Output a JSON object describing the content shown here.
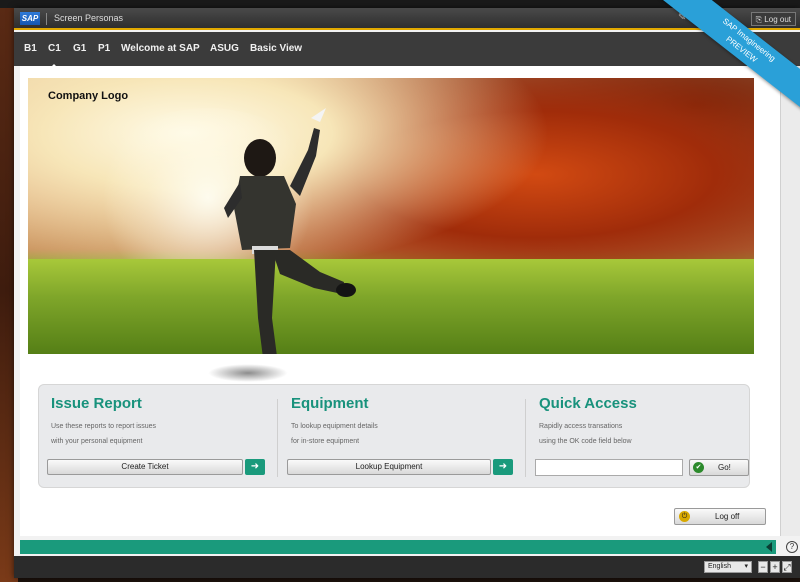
{
  "titlebar": {
    "app_logo": "SAP",
    "title": "Screen Personas",
    "logout_label": "Log out"
  },
  "tabs": [
    {
      "label": "B1"
    },
    {
      "label": "C1",
      "active": true
    },
    {
      "label": "G1"
    },
    {
      "label": "P1"
    },
    {
      "label": "Welcome at SAP"
    },
    {
      "label": "ASUG"
    },
    {
      "label": "Basic View"
    }
  ],
  "ribbon": {
    "line1": "SAP Imagineering",
    "line2": "PREVIEW"
  },
  "hero": {
    "company_logo": "Company Logo"
  },
  "panels": {
    "issue": {
      "title": "Issue Report",
      "desc_line1": "Use these reports to report issues",
      "desc_line2": "with your personal equipment",
      "button": "Create Ticket"
    },
    "equipment": {
      "title": "Equipment",
      "desc_line1": "To lookup equipment details",
      "desc_line2": "for in-store equipment",
      "button": "Lookup Equipment"
    },
    "quick": {
      "title": "Quick Access",
      "desc_line1": "Rapidly access transations",
      "desc_line2": "using the OK code field below",
      "input_value": "",
      "go_label": "Go!"
    }
  },
  "logoff_label": "Log off",
  "statusbar": {
    "language": "English",
    "zoom_out": "−",
    "zoom_in": "+"
  },
  "icons": {
    "go_arrow": "arrow-right-icon",
    "check": "check-icon",
    "logoff": "logoff-icon",
    "help": "help-icon"
  },
  "colors": {
    "accent_green": "#1a9a7c",
    "title_underline": "#e0a800",
    "ribbon_blue": "#2aa0d8"
  }
}
